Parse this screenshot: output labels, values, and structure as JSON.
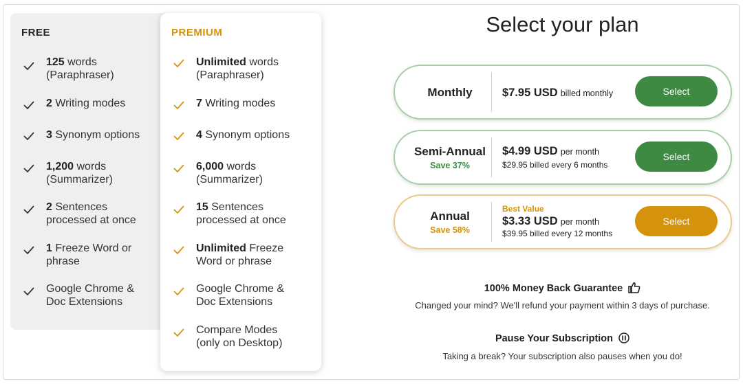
{
  "free": {
    "title": "FREE",
    "features": [
      {
        "strong": "125",
        "rest": " words",
        "line2": "(Paraphraser)"
      },
      {
        "strong": "2",
        "rest": " Writing modes",
        "line2": ""
      },
      {
        "strong": "3",
        "rest": " Synonym options",
        "line2": ""
      },
      {
        "strong": "1,200",
        "rest": " words",
        "line2": "(Summarizer)"
      },
      {
        "strong": "2",
        "rest": " Sentences",
        "line2": "processed at once"
      },
      {
        "strong": "1",
        "rest": " Freeze Word or",
        "line2": "phrase"
      },
      {
        "strong": "",
        "rest": "Google Chrome &",
        "line2": "Doc Extensions"
      }
    ]
  },
  "premium": {
    "title": "PREMIUM",
    "features": [
      {
        "strong": "Unlimited",
        "rest": " words",
        "line2": "(Paraphraser)"
      },
      {
        "strong": "7",
        "rest": " Writing modes",
        "line2": ""
      },
      {
        "strong": "4",
        "rest": " Synonym options",
        "line2": ""
      },
      {
        "strong": "6,000",
        "rest": " words",
        "line2": "(Summarizer)"
      },
      {
        "strong": "15",
        "rest": " Sentences",
        "line2": "processed at once"
      },
      {
        "strong": "Unlimited",
        "rest": " Freeze",
        "line2": "Word or phrase"
      },
      {
        "strong": "",
        "rest": "Google Chrome &",
        "line2": "Doc Extensions"
      },
      {
        "strong": "",
        "rest": "Compare Modes",
        "line2": "(only on Desktop)"
      }
    ]
  },
  "header": {
    "title": "Select your plan"
  },
  "plans": [
    {
      "name": "Monthly",
      "save": "",
      "best": "",
      "price": "$7.95 USD",
      "unit": "billed monthly",
      "sub": "",
      "button": "Select"
    },
    {
      "name": "Semi-Annual",
      "save": "Save 37%",
      "best": "",
      "price": "$4.99 USD",
      "unit": "per month",
      "sub": "$29.95 billed every 6 months",
      "button": "Select"
    },
    {
      "name": "Annual",
      "save": "Save 58%",
      "best": "Best Value",
      "price": "$3.33 USD",
      "unit": "per month",
      "sub": "$39.95 billed every 12 months",
      "button": "Select"
    }
  ],
  "guarantee": {
    "title": "100% Money Back Guarantee",
    "text": "Changed your mind? We'll refund your payment within 3 days of purchase."
  },
  "pause": {
    "title": "Pause Your Subscription",
    "text": "Taking a break? Your subscription also pauses when you do!"
  },
  "colors": {
    "green": "#3e8a43",
    "gold": "#d4930a",
    "free_check": "#333333"
  },
  "icons": {
    "check": "check-icon",
    "thumbs_up": "thumbs-up-icon",
    "pause": "pause-icon"
  }
}
